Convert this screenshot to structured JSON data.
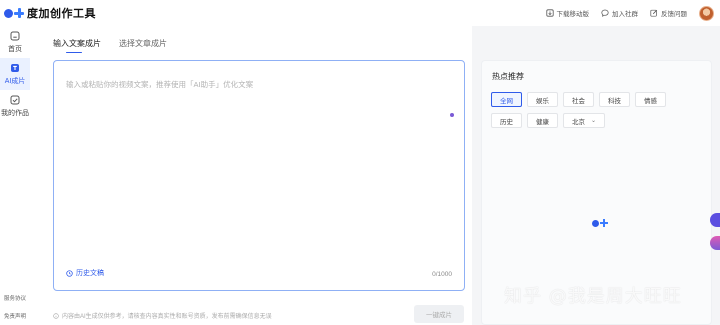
{
  "app": {
    "name": "度加创作工具"
  },
  "header": {
    "actions": [
      {
        "label": "下载移动版",
        "icon": "download-icon"
      },
      {
        "label": "加入社群",
        "icon": "chat-icon"
      },
      {
        "label": "反馈问题",
        "icon": "feedback-icon"
      }
    ]
  },
  "sidebar": {
    "items": [
      {
        "label": "首页",
        "icon": "home-icon"
      },
      {
        "label": "AI成片",
        "icon": "ai-video-icon",
        "active": true
      },
      {
        "label": "我的作品",
        "icon": "works-icon"
      }
    ],
    "footer": [
      "服务协议",
      "免责声明"
    ]
  },
  "main": {
    "tabs": [
      {
        "label": "输入文案成片",
        "active": true
      },
      {
        "label": "选择文章成片"
      }
    ],
    "editor": {
      "placeholder": "输入或粘贴你的视频文案，推荐使用「AI助手」优化文案",
      "history_label": "历史文稿",
      "counter": "0/1000"
    },
    "disclaimer": "内容由AI生成仅供参考，请核查内容真实性和账号资质，发布前需确保信息无误",
    "generate_label": "一键成片"
  },
  "hot": {
    "title": "热点推荐",
    "chips": [
      {
        "label": "全网",
        "active": true
      },
      {
        "label": "娱乐"
      },
      {
        "label": "社会"
      },
      {
        "label": "科技"
      },
      {
        "label": "情感"
      },
      {
        "label": "历史"
      },
      {
        "label": "健康"
      },
      {
        "label": "北京",
        "dropdown": true
      }
    ]
  },
  "watermark": "知乎 @我是周大旺旺",
  "colors": {
    "accent": "#2f5bea",
    "editor_border": "#8fb0f5"
  }
}
